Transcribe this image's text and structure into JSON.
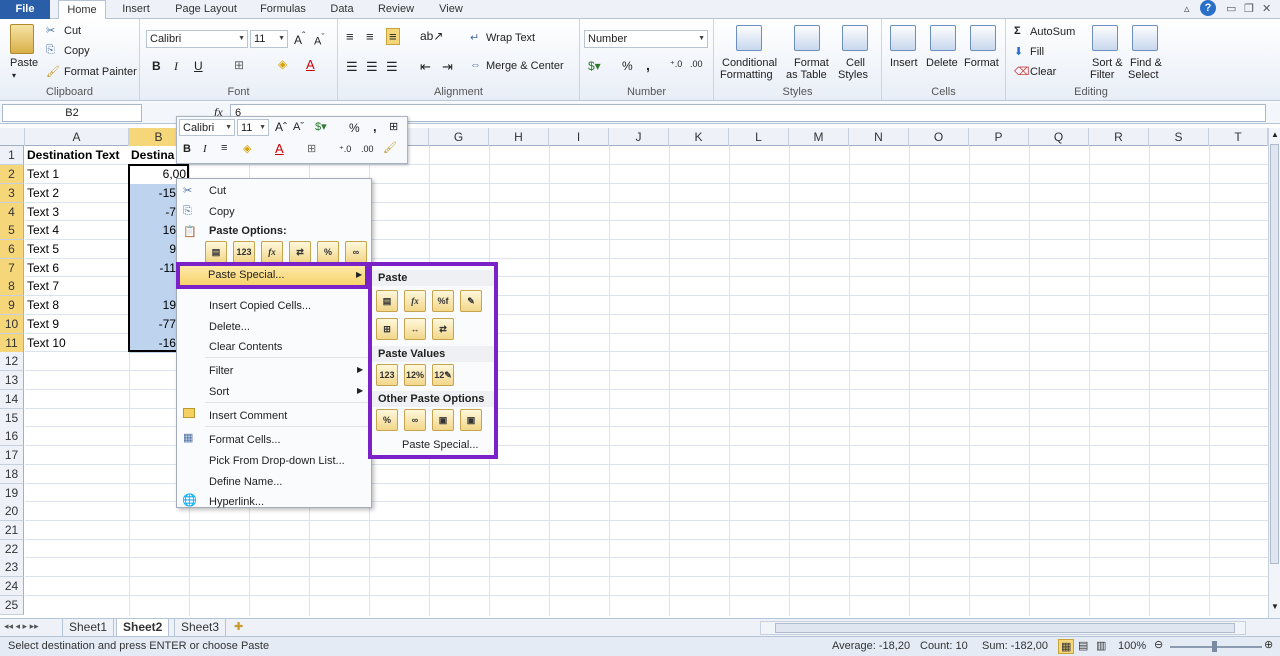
{
  "tabs": [
    "File",
    "Home",
    "Insert",
    "Page Layout",
    "Formulas",
    "Data",
    "Review",
    "View"
  ],
  "clipboard": {
    "paste": "Paste",
    "cut": "Cut",
    "copy": "Copy",
    "format_painter": "Format Painter",
    "label": "Clipboard"
  },
  "font": {
    "name": "Calibri",
    "size": "11",
    "label": "Font",
    "bold": "B",
    "italic": "I",
    "underline": "U"
  },
  "alignment": {
    "wrap": "Wrap Text",
    "merge": "Merge & Center",
    "label": "Alignment"
  },
  "number": {
    "format": "Number",
    "percent": "%",
    "comma": ",",
    "label": "Number"
  },
  "styles": {
    "conditional": "Conditional",
    "formatting": "Formatting",
    "format_as": "Format",
    "as_table": "as Table",
    "cell": "Cell",
    "cell_styles": "Styles",
    "label": "Styles"
  },
  "cells": {
    "insert": "Insert",
    "delete": "Delete",
    "format": "Format",
    "label": "Cells"
  },
  "editing": {
    "autosum": "AutoSum",
    "fill": "Fill",
    "clear": "Clear",
    "sort": "Sort &",
    "filter": "Filter",
    "find": "Find &",
    "select": "Select",
    "label": "Editing"
  },
  "formula_bar": {
    "name_box": "B2",
    "fx": "fx",
    "value": "6"
  },
  "columns": [
    "A",
    "B",
    "C",
    "D",
    "E",
    "F",
    "G",
    "H",
    "I",
    "J",
    "K",
    "L",
    "M",
    "N",
    "O",
    "P",
    "Q",
    "R",
    "S",
    "T"
  ],
  "rows": [
    "1",
    "2",
    "3",
    "4",
    "5",
    "6",
    "7",
    "8",
    "9",
    "10",
    "11",
    "12",
    "13",
    "14",
    "15",
    "16",
    "17",
    "18",
    "19",
    "20",
    "21",
    "22",
    "23",
    "24",
    "25"
  ],
  "colA": [
    "Destination Text",
    "Text 1",
    "Text 2",
    "Text 3",
    "Text 4",
    "Text 5",
    "Text 6",
    "Text 7",
    "Text 8",
    "Text 9",
    "Text 10"
  ],
  "colB": [
    "Destina",
    "6,00",
    "-15,0",
    "-7,0",
    "16,0",
    "9,0",
    "-117,",
    "0,",
    "19,0",
    "-77,0",
    "-16,0"
  ],
  "mini_toolbar": {
    "font": "Calibri",
    "size": "11",
    "percent": "%",
    "comma": ","
  },
  "context_menu": {
    "cut": "Cut",
    "copy": "Copy",
    "paste_options": "Paste Options:",
    "paste_special": "Paste Special...",
    "insert_copied": "Insert Copied Cells...",
    "delete": "Delete...",
    "clear": "Clear Contents",
    "filter": "Filter",
    "sort": "Sort",
    "insert_comment": "Insert Comment",
    "format_cells": "Format Cells...",
    "pick_list": "Pick From Drop-down List...",
    "define_name": "Define Name...",
    "hyperlink": "Hyperlink..."
  },
  "submenu": {
    "paste": "Paste",
    "paste_values": "Paste Values",
    "other": "Other Paste Options",
    "paste_special": "Paste Special..."
  },
  "sheets": [
    "Sheet1",
    "Sheet2",
    "Sheet3"
  ],
  "status": {
    "message": "Select destination and press ENTER or choose Paste",
    "average": "Average: -18,20",
    "count": "Count: 10",
    "sum": "Sum: -182,00",
    "zoom": "100%"
  },
  "accent": "#7a22c8"
}
